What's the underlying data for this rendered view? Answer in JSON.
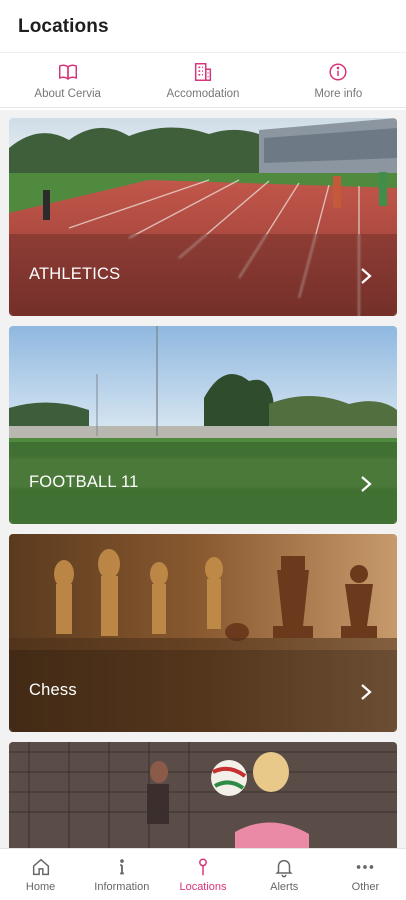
{
  "header": {
    "title": "Locations"
  },
  "top_tabs": [
    {
      "label": "About Cervia",
      "icon": "book-icon"
    },
    {
      "label": "Accomodation",
      "icon": "building-icon"
    },
    {
      "label": "More info",
      "icon": "info-circle-icon"
    }
  ],
  "cards": [
    {
      "title": "ATHLETICS",
      "image": "running-track-photo"
    },
    {
      "title": "FOOTBALL 11",
      "image": "football-field-photo"
    },
    {
      "title": "Chess",
      "image": "chess-pieces-photo"
    },
    {
      "title": "",
      "image": "volleyball-players-photo"
    }
  ],
  "bottom_nav": [
    {
      "label": "Home",
      "icon": "home-icon",
      "active": false
    },
    {
      "label": "Information",
      "icon": "info-icon",
      "active": false
    },
    {
      "label": "Locations",
      "icon": "location-pin-icon",
      "active": true
    },
    {
      "label": "Alerts",
      "icon": "bell-icon",
      "active": false
    },
    {
      "label": "Other",
      "icon": "more-dots-icon",
      "active": false
    }
  ],
  "colors": {
    "accent": "#d6337a",
    "inactive": "#777777"
  }
}
